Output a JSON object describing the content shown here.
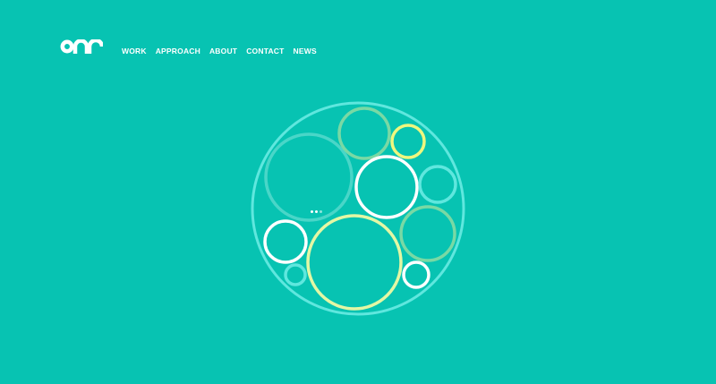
{
  "colors": {
    "background": "#07c3b2",
    "white": "#ffffff",
    "aqua": "#5fe7de",
    "mint": "#79d9a4",
    "pale_yellow": "#e3f7a4",
    "yellow": "#eef77e",
    "faded_teal": "#49d6c8"
  },
  "header": {
    "logo_icon": "one-logo-icon",
    "nav": [
      {
        "label": "WORK"
      },
      {
        "label": "APPROACH"
      },
      {
        "label": "ABOUT"
      },
      {
        "label": "CONTACT"
      },
      {
        "label": "NEWS"
      }
    ]
  },
  "hero": {
    "graphic_icon": "packed-circles-graphic",
    "loader": {
      "dots": 3,
      "active_index": 1
    }
  }
}
